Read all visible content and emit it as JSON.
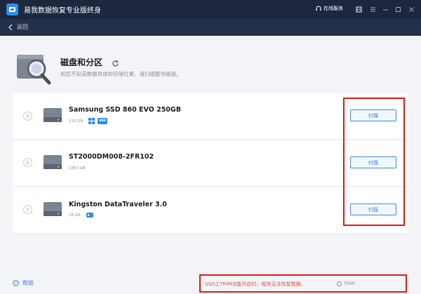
{
  "app": {
    "title": "易我数据恢复专业版终身",
    "support_label": "在线服务"
  },
  "nav": {
    "back_label": "返回"
  },
  "page": {
    "title": "磁盘和分区",
    "subtitle": "如您不知道数据具体的存储位置，请扫描整块磁盘。"
  },
  "disks": [
    {
      "name": "Samsung SSD 860 EVO 250GB",
      "size": "232 GB",
      "badges": [
        "windows-badge",
        "ssd-badge"
      ],
      "scan_label": "扫描"
    },
    {
      "name": "ST2000DM008-2FR102",
      "size": "1863 GB",
      "badges": [],
      "scan_label": "扫描"
    },
    {
      "name": "Kingston DataTraveler 3.0",
      "size": "28 GB",
      "badges": [
        "usb-badge"
      ],
      "scan_label": "扫描"
    }
  ],
  "badges": {
    "ssd_label": "SSD"
  },
  "footer": {
    "help_label": "帮助",
    "trim_warning": "SSD上TRIM功能开启时，程序无法恢复数据。",
    "trim_link": "TRIM"
  },
  "colors": {
    "titlebar": "#1d2740",
    "navbar": "#243049",
    "accent": "#3b82d6",
    "highlight": "#e02020"
  }
}
